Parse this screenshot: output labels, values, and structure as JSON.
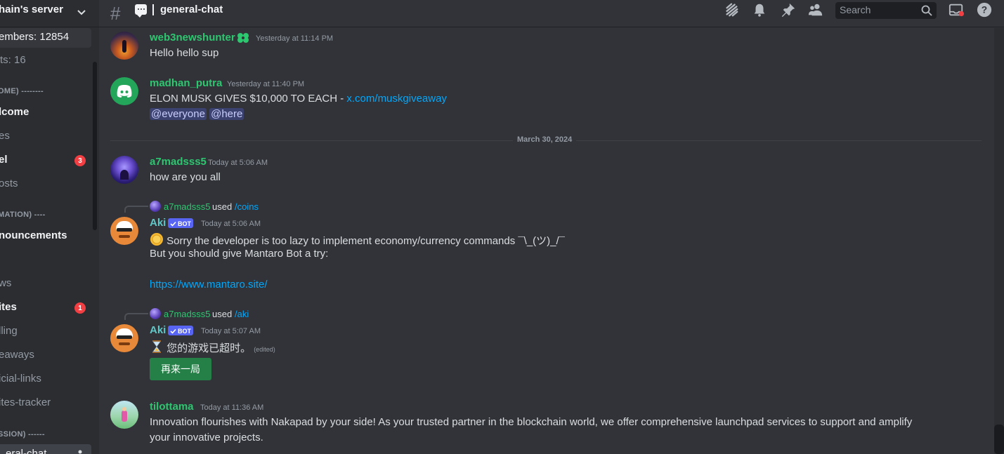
{
  "sidebar": {
    "server_name": "hain's server",
    "rows": [
      {
        "text": "embers: 12854",
        "style": "stat"
      },
      {
        "text": "ts: 16",
        "style": "stat"
      },
      {
        "text": "OME) --------",
        "style": "cat"
      },
      {
        "text": "lcome",
        "style": "bright"
      },
      {
        "text": "es",
        "style": "muted"
      },
      {
        "text": "el",
        "style": "bright",
        "badge": "3"
      },
      {
        "text": "osts",
        "style": "muted"
      },
      {
        "text": "MATION) ----",
        "style": "cat"
      },
      {
        "text": "nouncements",
        "style": "bright"
      },
      {
        "text": "ws",
        "style": "muted"
      },
      {
        "text": "ites",
        "style": "bright",
        "badge": "1"
      },
      {
        "text": "lling",
        "style": "muted"
      },
      {
        "text": "eaways",
        "style": "muted"
      },
      {
        "text": "icial-links",
        "style": "muted"
      },
      {
        "text": "ites-tracker",
        "style": "muted"
      },
      {
        "text": "SSION) ------",
        "style": "cat"
      },
      {
        "text": "eral-chat",
        "style": "active"
      }
    ]
  },
  "topbar": {
    "channel_title": "general-chat",
    "search_placeholder": "Search",
    "icons": [
      "threads-icon",
      "notification-bell-icon",
      "pin-icon",
      "member-list-icon",
      "inbox-icon",
      "help-icon"
    ]
  },
  "messages": [
    {
      "author": "web3newshunter",
      "timestamp": "Yesterday at 11:14 PM",
      "lines": [
        "Hello hello sup"
      ]
    },
    {
      "author": "madhan_putra",
      "timestamp": "Yesterday at 11:40 PM",
      "text": "ELON MUSK GIVES $10,000 TO EACH - ",
      "link": "x.com/muskgiveaway",
      "mentions": [
        "@everyone",
        "@here"
      ]
    },
    {
      "author": "a7madsss5",
      "timestamp": "Today at 5:06 AM",
      "lines": [
        "how are you all"
      ]
    },
    {
      "reply_user": "a7madsss5",
      "reply_used": "used",
      "reply_command": "/coins",
      "author": "Aki",
      "bot_tag": "BOT",
      "timestamp": "Today at 5:06 AM",
      "line1": "Sorry the developer is too lazy to implement economy/currency commands ¯\\_(ツ)_/¯",
      "line2": "But you should give Mantaro Bot a try:",
      "link": "https://www.mantaro.site/"
    },
    {
      "reply_user": "a7madsss5",
      "reply_used": "used",
      "reply_command": "/aki",
      "author": "Aki",
      "bot_tag": "BOT",
      "timestamp": "Today at 5:07 AM",
      "line1": "您的游戏已超时。",
      "edited": "(edited)",
      "button": "再来一局"
    },
    {
      "author": "tilottama",
      "timestamp": "Today at 11:36 AM",
      "line1": "Innovation flourishes with Nakapad by your side! As your trusted partner in the blockchain world, we offer comprehensive launchpad services to support and amplify",
      "line2": "your innovative projects."
    }
  ],
  "date_divider": "March 30, 2024",
  "colors": {
    "username_green": "#2dc770",
    "bot_name": "#5fc9c9",
    "link": "#00a8fc",
    "bot_badge": "#5865f2",
    "button_green": "#248046"
  }
}
